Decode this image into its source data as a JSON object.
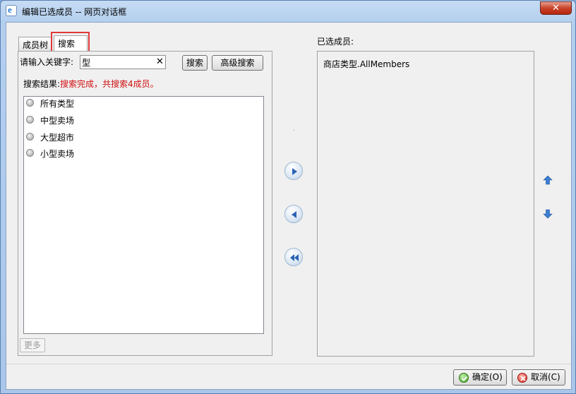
{
  "window": {
    "title": "编辑已选成员 -- 网页对话框",
    "close_glyph": "✕"
  },
  "tabs": {
    "members": "成员树",
    "search": "搜索"
  },
  "search": {
    "keyword_label": "请输入关键字:",
    "keyword_value": "型",
    "clear_glyph": "✕",
    "search_button": "搜索",
    "advanced_button": "高级搜索",
    "result_label": "搜索结果:",
    "result_status": "搜索完成，共搜索4成员。",
    "results": [
      "所有类型",
      "中型卖场",
      "大型超市",
      "小型卖场"
    ],
    "more_button": "更多"
  },
  "selected": {
    "label": "已选成员:",
    "items": [
      "商店类型.AllMembers"
    ]
  },
  "footer": {
    "ok_button": "确定(O)",
    "cancel_button": "取消(C)"
  },
  "colors": {
    "highlight_box": "#e0383b",
    "status_text": "#d11010",
    "arrow_blue": "#2a63b5"
  }
}
